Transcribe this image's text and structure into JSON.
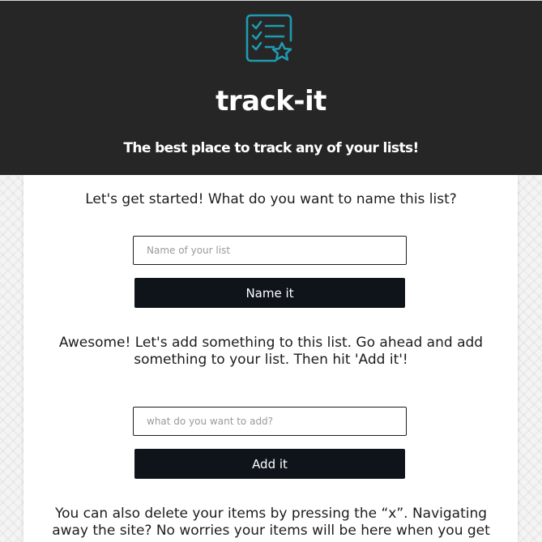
{
  "header": {
    "logo_icon": "checklist-star-icon",
    "title": "track-it",
    "subtitle": "The best place to track any of your lists!",
    "background": "#262626",
    "accent": "#1f9bb0"
  },
  "name_section": {
    "prompt": "Let's get started! What do you want to name this list?",
    "input_placeholder": "Name of your list",
    "input_value": "",
    "button_label": "Name it"
  },
  "add_section": {
    "prompt_line1": "Awesome! Let's add something to this list. Go ahead and add",
    "prompt_line2": "something to your list. Then hit 'Add it'!",
    "input_placeholder": "what do you want to add?",
    "input_value": "",
    "button_label": "Add it"
  },
  "info_section": {
    "line1": "You can also delete your items by pressing the “x”. Navigating",
    "line2": "away the site? No worries your items will be here when you get"
  }
}
